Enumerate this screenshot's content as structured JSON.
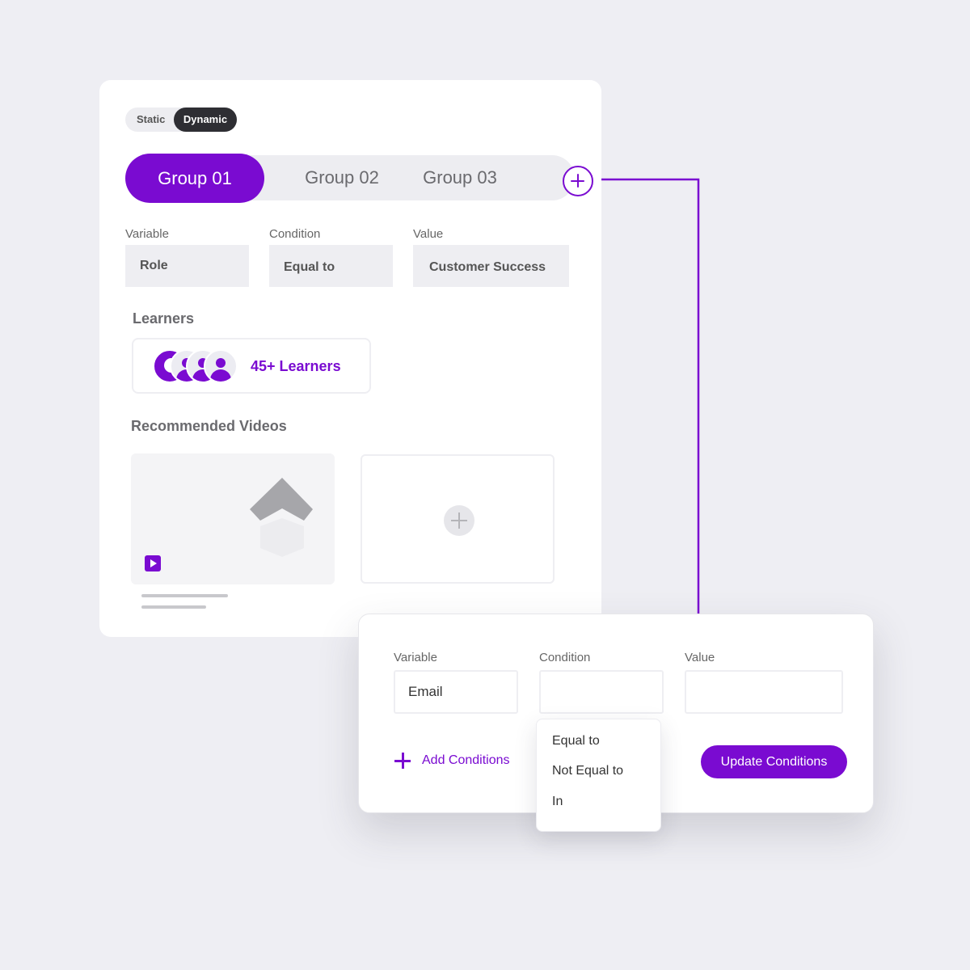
{
  "mode_toggle": {
    "static_label": "Static",
    "dynamic_label": "Dynamic",
    "selected": "Dynamic"
  },
  "group_tabs": [
    {
      "label": "Group 01",
      "active": true
    },
    {
      "label": "Group 02",
      "active": false
    },
    {
      "label": "Group 03",
      "active": false
    }
  ],
  "add_group_icon": "plus-circle-icon",
  "main_fields": {
    "variable": {
      "label": "Variable",
      "value": "Role"
    },
    "condition": {
      "label": "Condition",
      "value": "Equal to"
    },
    "value": {
      "label": "Value",
      "value": "Customer Success"
    }
  },
  "learners": {
    "title": "Learners",
    "count_label": "45+ Learners"
  },
  "recommended": {
    "title": "Recommended Videos"
  },
  "conditions_panel": {
    "variable": {
      "label": "Variable",
      "value": "Email"
    },
    "condition": {
      "label": "Condition",
      "value": ""
    },
    "value": {
      "label": "Value",
      "value": ""
    },
    "add_label": "Add Conditions",
    "update_label": "Update Conditions"
  },
  "condition_options": [
    "Equal to",
    "Not Equal to",
    "In"
  ],
  "colors": {
    "accent": "#7a0bd1",
    "background": "#eeeef3",
    "dark_pill": "#2e2e33",
    "field_fill": "#eeeef2"
  }
}
